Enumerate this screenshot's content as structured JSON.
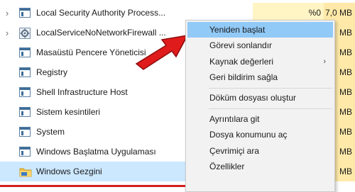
{
  "processes": [
    {
      "name": "Local Security Authority Process...",
      "cpu": "%0",
      "memory": "7,0 MB",
      "icon": "window-icon",
      "expandable": true
    },
    {
      "name": "LocalServiceNoNetworkFirewall ...",
      "cpu": "",
      "memory": "MB",
      "icon": "gear-icon",
      "expandable": true
    },
    {
      "name": "Masaüstü Pencere Yöneticisi",
      "cpu": "",
      "memory": "MB",
      "icon": "window-icon",
      "expandable": false
    },
    {
      "name": "Registry",
      "cpu": "",
      "memory": "MB",
      "icon": "window-icon",
      "expandable": false
    },
    {
      "name": "Shell Infrastructure Host",
      "cpu": "",
      "memory": "MB",
      "icon": "window-icon",
      "expandable": false
    },
    {
      "name": "Sistem kesintileri",
      "cpu": "",
      "memory": "MB",
      "icon": "window-icon",
      "expandable": false
    },
    {
      "name": "System",
      "cpu": "",
      "memory": "MB",
      "icon": "window-icon",
      "expandable": false
    },
    {
      "name": "Windows Başlatma Uygulaması",
      "cpu": "",
      "memory": "MB",
      "icon": "window-icon",
      "expandable": false
    },
    {
      "name": "Windows Gezgini",
      "cpu": "",
      "memory": "MB",
      "icon": "folder-icon",
      "expandable": false,
      "selected": true
    }
  ],
  "context_menu": {
    "items": [
      {
        "label": "Yeniden başlat",
        "highlighted": true
      },
      {
        "label": "Görevi sonlandır"
      },
      {
        "label": "Kaynak değerleri",
        "has_submenu": true
      },
      {
        "label": "Geri bildirim sağla"
      },
      {
        "label": "Döküm dosyası oluştur"
      },
      {
        "label": "Ayrıntılara git"
      },
      {
        "label": "Dosya konumunu aç"
      },
      {
        "label": "Çevrimiçi ara"
      },
      {
        "label": "Özellikler"
      }
    ],
    "submenu_arrow": "›"
  },
  "colors": {
    "selected_row": "#cce8ff",
    "menu_highlight": "#91c9f7",
    "cpu_column": "#fff4c4",
    "memory_column": "#ffe9a8",
    "annotation_arrow": "#e01b1b"
  }
}
